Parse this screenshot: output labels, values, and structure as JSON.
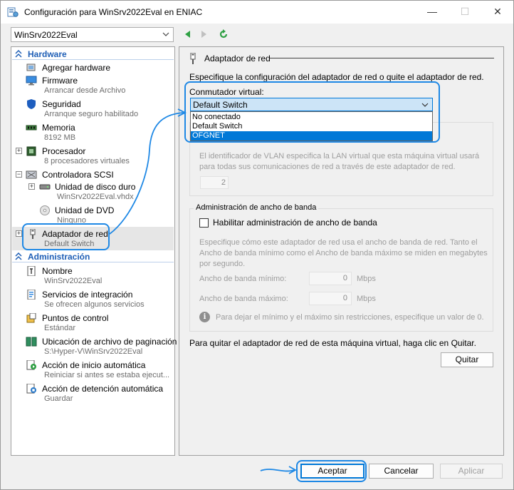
{
  "window": {
    "title": "Configuración para WinSrv2022Eval en ENIAC",
    "min_glyph": "—",
    "max_glyph": "☐",
    "close_glyph": "✕"
  },
  "vm_selector": {
    "value": "WinSrv2022Eval"
  },
  "sidebar": {
    "hardware_header": "Hardware",
    "admin_header": "Administración",
    "hardware_items": [
      {
        "title": "Agregar hardware",
        "sub": "",
        "icon": "add-hardware-icon"
      },
      {
        "title": "Firmware",
        "sub": "Arrancar desde Archivo",
        "icon": "firmware-icon"
      },
      {
        "title": "Seguridad",
        "sub": "Arranque seguro habilitado",
        "icon": "shield-icon"
      },
      {
        "title": "Memoria",
        "sub": "8192 MB",
        "icon": "memory-icon"
      },
      {
        "title": "Procesador",
        "sub": "8 procesadores virtuales",
        "icon": "processor-icon"
      },
      {
        "title": "Controladora SCSI",
        "sub": "",
        "icon": "scsi-controller-icon"
      },
      {
        "title": "Unidad de disco duro",
        "sub": "WinSrv2022Eval.vhdx",
        "icon": "hard-disk-icon"
      },
      {
        "title": "Unidad de DVD",
        "sub": "Ninguno",
        "icon": "dvd-icon"
      },
      {
        "title": "Adaptador de red",
        "sub": "Default Switch",
        "icon": "network-adapter-icon"
      }
    ],
    "admin_items": [
      {
        "title": "Nombre",
        "sub": "WinSrv2022Eval",
        "icon": "name-icon"
      },
      {
        "title": "Servicios de integración",
        "sub": "Se ofrecen algunos servicios",
        "icon": "integration-services-icon"
      },
      {
        "title": "Puntos de control",
        "sub": "Estándar",
        "icon": "checkpoint-icon"
      },
      {
        "title": "Ubicación de archivo de paginación ...",
        "sub": "S:\\Hyper-V\\WinSrv2022Eval",
        "icon": "paging-file-icon"
      },
      {
        "title": "Acción de inicio automática",
        "sub": "Reiniciar si antes se estaba ejecut...",
        "icon": "auto-start-icon"
      },
      {
        "title": "Acción de detención automática",
        "sub": "Guardar",
        "icon": "auto-stop-icon"
      }
    ]
  },
  "pane": {
    "header": "Adaptador de red",
    "description": "Especifique la configuración del adaptador de red o quite el adaptador de red.",
    "switch_label": "Conmutador virtual:",
    "switch_value": "Default Switch",
    "switch_options": [
      "No conectado",
      "Default Switch",
      "OFGNET"
    ],
    "switch_selected_index": 2,
    "vlan_description": "El identificador de VLAN especifica la LAN virtual que esta máquina virtual usará para todas sus comunicaciones de red a través de este adaptador de red.",
    "vlan_id": "2",
    "bandwidth_title": "Administración de ancho de banda",
    "bandwidth_enable_label": "Habilitar administración de ancho de banda",
    "bandwidth_enabled": false,
    "bandwidth_description": "Especifique cómo este adaptador de red usa el ancho de banda de red. Tanto el Ancho de banda mínimo como el Ancho de banda máximo se miden en megabytes por segundo.",
    "min_label": "Ancho de banda mínimo:",
    "min_value": "0",
    "max_label": "Ancho de banda máximo:",
    "max_value": "0",
    "unit": "Mbps",
    "info_text": "Para dejar el mínimo y el máximo sin restricciones, especifique un valor de 0.",
    "remove_description": "Para quitar el adaptador de red de esta máquina virtual, haga clic en Quitar.",
    "remove_button": "Quitar"
  },
  "footer": {
    "ok": "Aceptar",
    "cancel": "Cancelar",
    "apply": "Aplicar"
  },
  "colors": {
    "accent": "#0078d7",
    "callout": "#1e88e5",
    "section_header": "#1f5fb6"
  }
}
